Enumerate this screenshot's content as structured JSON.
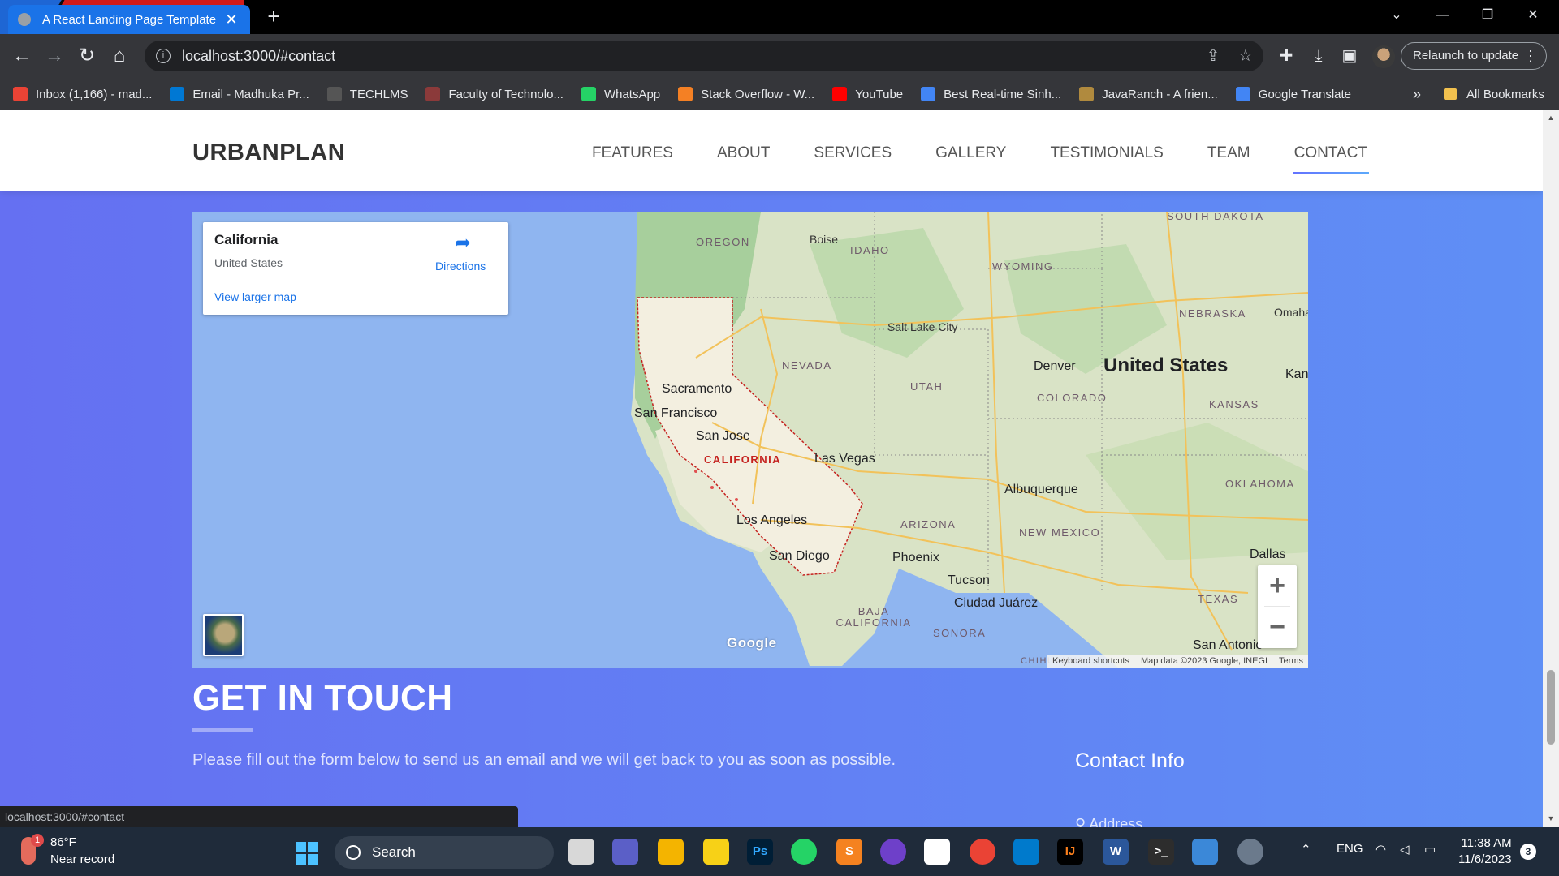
{
  "browser": {
    "tab_title": "A React Landing Page Template",
    "url": "localhost:3000/#contact",
    "relaunch_label": "Relaunch to update",
    "bookmarks": [
      {
        "label": "Inbox (1,166) - mad...",
        "icon": "gmail-icon",
        "color": "#ea4335"
      },
      {
        "label": "Email - Madhuka Pr...",
        "icon": "outlook-icon",
        "color": "#0078d4"
      },
      {
        "label": "TECHLMS",
        "icon": "techlms-icon",
        "color": "#555555"
      },
      {
        "label": "Faculty of Technolo...",
        "icon": "faculty-icon",
        "color": "#8b3a3a"
      },
      {
        "label": "WhatsApp",
        "icon": "whatsapp-icon",
        "color": "#25d366"
      },
      {
        "label": "Stack Overflow - W...",
        "icon": "stackoverflow-icon",
        "color": "#f48024"
      },
      {
        "label": "YouTube",
        "icon": "youtube-icon",
        "color": "#ff0000"
      },
      {
        "label": "Best Real-time Sinh...",
        "icon": "google-icon",
        "color": "#4285f4"
      },
      {
        "label": "JavaRanch - A frien...",
        "icon": "javaranch-icon",
        "color": "#b08a3e"
      },
      {
        "label": "Google Translate",
        "icon": "translate-icon",
        "color": "#4285f4"
      }
    ],
    "all_bookmarks": "All Bookmarks",
    "status_url": "localhost:3000/#contact"
  },
  "site": {
    "brand": "URBANPLAN",
    "menu": [
      "FEATURES",
      "ABOUT",
      "SERVICES",
      "GALLERY",
      "TESTIMONIALS",
      "TEAM",
      "CONTACT"
    ],
    "active_menu": "CONTACT"
  },
  "map": {
    "place_name": "California",
    "place_sub": "United States",
    "directions": "Directions",
    "view_larger": "View larger map",
    "google": "Google",
    "attribution": [
      "Keyboard shortcuts",
      "Map data ©2023 Google, INEGI",
      "Terms"
    ],
    "labels": {
      "oregon": "OREGON",
      "idaho": "IDAHO",
      "wyoming": "WYOMING",
      "south_dakota": "SOUTH DAKOTA",
      "nebraska": "NEBRASKA",
      "nevada": "NEVADA",
      "utah": "UTAH",
      "colorado": "COLORADO",
      "kansas": "KANSAS",
      "california": "CALIFORNIA",
      "arizona": "ARIZONA",
      "new_mexico": "NEW MEXICO",
      "oklahoma": "OKLAHOMA",
      "texas": "TEXAS",
      "baja": "BAJA CALIFORNIA",
      "sonora": "SONORA",
      "chihuahua": "CHIHUAHUA",
      "boise": "Boise",
      "omaha": "Omaha",
      "salt_lake": "Salt Lake City",
      "denver": "Denver",
      "united_states": "United States",
      "kan": "Kan",
      "sacramento": "Sacramento",
      "san_francisco": "San Francisco",
      "san_jose": "San Jose",
      "las_vegas": "Las Vegas",
      "albuquerque": "Albuquerque",
      "los_angeles": "Los Angeles",
      "san_diego": "San Diego",
      "phoenix": "Phoenix",
      "tucson": "Tucson",
      "ciudad_juarez": "Ciudad Juárez",
      "dallas": "Dallas",
      "san_antonio": "San Antonio"
    }
  },
  "contact": {
    "title": "GET IN TOUCH",
    "description": "Please fill out the form below to send us an email and we will get back to you as soon as possible.",
    "info_title": "Contact Info",
    "address_label": "Address"
  },
  "taskbar": {
    "weather_temp": "86°F",
    "weather_desc": "Near record",
    "weather_badge": "1",
    "search": "Search",
    "lang": "ENG",
    "time": "11:38 AM",
    "date": "11/6/2023",
    "notifications": "3"
  },
  "colors": {
    "page_gradient_start": "#6570f2",
    "page_gradient_end": "#5f8ff5",
    "link_blue": "#1a73e8",
    "ca_border": "#c5221f"
  }
}
